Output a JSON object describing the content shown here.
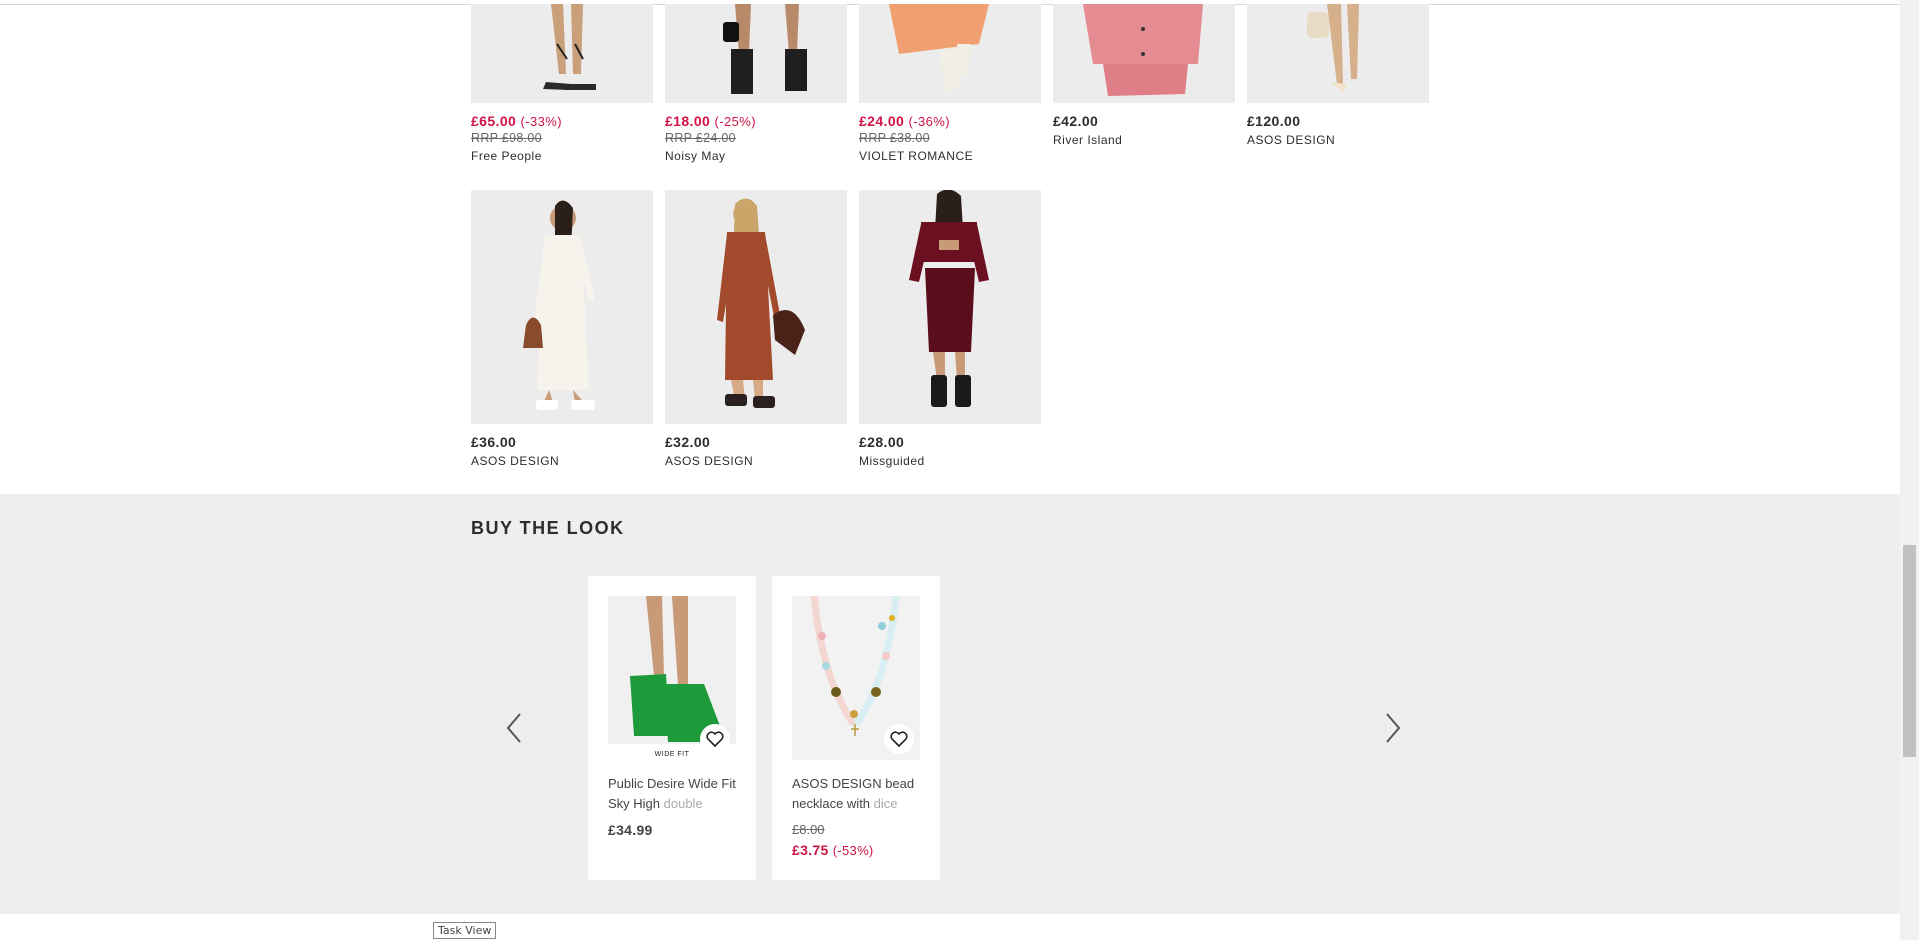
{
  "grid_row1": [
    {
      "price": "£65.00",
      "discount": "(-33%)",
      "rrp": "RRP £98.00",
      "brand": "Free People",
      "sale": true
    },
    {
      "price": "£18.00",
      "discount": "(-25%)",
      "rrp": "RRP £24.00",
      "brand": "Noisy May",
      "sale": true
    },
    {
      "price": "£24.00",
      "discount": "(-36%)",
      "rrp": "RRP £38.00",
      "brand": "VIOLET ROMANCE",
      "sale": true
    },
    {
      "price": "£42.00",
      "discount": "",
      "rrp": "",
      "brand": "River Island",
      "sale": false
    },
    {
      "price": "£120.00",
      "discount": "",
      "rrp": "",
      "brand": "ASOS DESIGN",
      "sale": false
    }
  ],
  "grid_row2": [
    {
      "price": "£36.00",
      "brand": "ASOS DESIGN"
    },
    {
      "price": "£32.00",
      "brand": "ASOS DESIGN"
    },
    {
      "price": "£28.00",
      "brand": "Missguided"
    }
  ],
  "buy_the_look": {
    "title": "BUY THE LOOK",
    "cards": [
      {
        "title_main": "Public Desire Wide Fit Sky High ",
        "title_fade": "double",
        "badge": "WIDE FIT",
        "price": "£34.99"
      },
      {
        "title_main": "ASOS DESIGN bead necklace with ",
        "title_fade": "dice",
        "was": "£8.00",
        "price": "£3.75",
        "discount": "(-53%)"
      }
    ]
  },
  "taskbar_tooltip": "Task View",
  "colors": {
    "sale": "#d01345",
    "section_bg": "#eeeeee",
    "shoe_green": "#1d9a3a",
    "dress_maroon": "#6b1020",
    "dress_rust": "#a14b2c"
  },
  "icons": [
    "heart-icon",
    "chevron-left-icon",
    "chevron-right-icon"
  ]
}
